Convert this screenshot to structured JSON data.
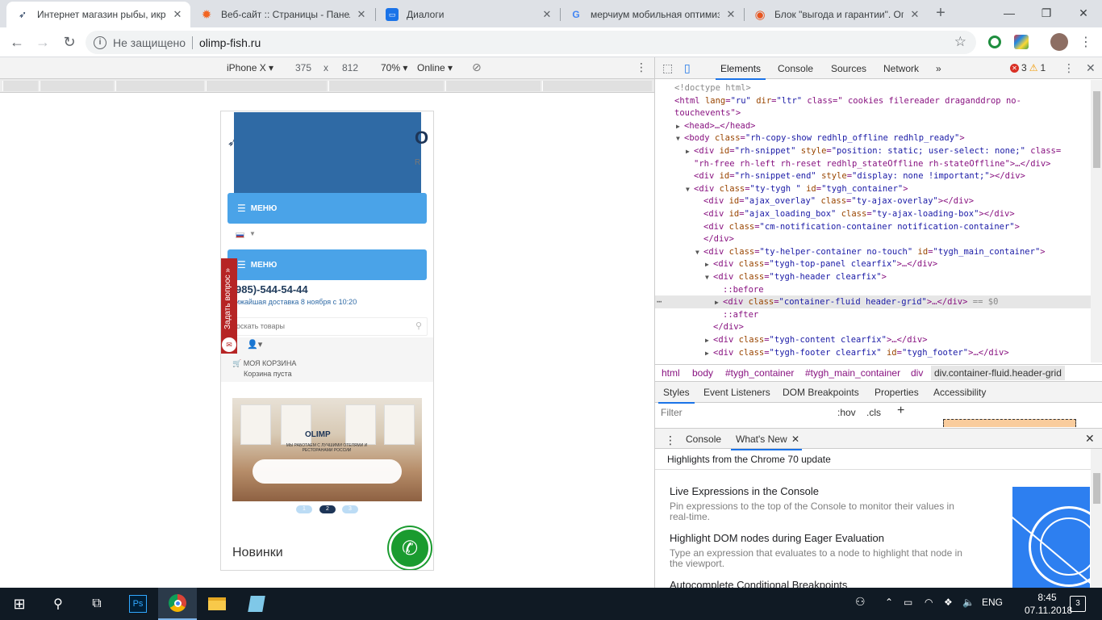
{
  "browser": {
    "tabs": [
      {
        "title": "Интернет магазин рыбы, икр",
        "icon": "olimp-favicon",
        "active": true
      },
      {
        "title": "Веб-сайт :: Страницы - Панел",
        "icon": "gear-favicon",
        "active": false
      },
      {
        "title": "Диалоги",
        "icon": "chat-favicon",
        "active": false
      },
      {
        "title": "мерчиум мобильная оптимиз",
        "icon": "google-favicon",
        "active": false
      },
      {
        "title": "Блок \"выгода и гарантии\". Оп",
        "icon": "support-favicon",
        "active": false
      }
    ],
    "new_tab_icon": "+",
    "minimize_icon": "—",
    "maximize_icon": "❐",
    "close_icon": "✕",
    "security_label": "Не защищено",
    "url": "olimp-fish.ru"
  },
  "device_toolbar": {
    "device": "iPhone X",
    "width": "375",
    "times": "x",
    "height": "812",
    "zoom": "70%",
    "network": "Online"
  },
  "mobile_page": {
    "menu_label": "МЕНЮ",
    "menu_label_2": "МЕНЮ",
    "logo_fragment": "O",
    "logo_fragment_r": "R",
    "phone": "985)-544-54-44",
    "delivery": "ижайшая доставка 8 ноября с 10:20",
    "search_placeholder": "оскать товары",
    "cart_title": "МОЯ КОРЗИНА",
    "cart_subtitle": "Корзина пуста",
    "banner_logo": "OLIMP",
    "banner_text": "МЫ РАБОТАЕМ С ЛУЧШИМИ ОТЕЛЯМИ И РЕСТОРАНАМИ РОССИИ",
    "slider_dots": [
      "1",
      "2",
      "3"
    ],
    "active_dot": 2,
    "section_title": "Новинки",
    "ask_question": "Задать вопрос »"
  },
  "devtools": {
    "tabs": [
      "Elements",
      "Console",
      "Sources",
      "Network"
    ],
    "more": "»",
    "errors": "3",
    "warnings": "1",
    "dom_lines": [
      {
        "indent": 0,
        "tri": "",
        "html": "<!doctype html>",
        "type": "comment"
      },
      {
        "indent": 0,
        "tri": "",
        "text": "<html lang=\"ru\" dir=\"ltr\" class=\" cookies filereader draganddrop no-"
      },
      {
        "indent": 0,
        "tri": "",
        "text": "touchevents\">"
      },
      {
        "indent": 1,
        "tri": "▶",
        "text": "<head>…</head>"
      },
      {
        "indent": 1,
        "tri": "▼",
        "text": "<body class=\"rh-copy-show redhlp_offline redhlp_ready\">"
      },
      {
        "indent": 2,
        "tri": "▶",
        "text": "<div id=\"rh-snippet\" style=\"position: static; user-select: none;\" class="
      },
      {
        "indent": 2,
        "tri": "",
        "text": "\"rh-free rh-left rh-reset redhlp_stateOffline rh-stateOffline\">…</div>"
      },
      {
        "indent": 2,
        "tri": "",
        "text": "<div id=\"rh-snippet-end\" style=\"display: none !important;\"></div>"
      },
      {
        "indent": 2,
        "tri": "▼",
        "text": "<div class=\"ty-tygh  \" id=\"tygh_container\">"
      },
      {
        "indent": 3,
        "tri": "",
        "text": "<div id=\"ajax_overlay\" class=\"ty-ajax-overlay\"></div>"
      },
      {
        "indent": 3,
        "tri": "",
        "text": "<div id=\"ajax_loading_box\" class=\"ty-ajax-loading-box\"></div>"
      },
      {
        "indent": 3,
        "tri": "",
        "text": "<div class=\"cm-notification-container notification-container\">"
      },
      {
        "indent": 3,
        "tri": "",
        "text": "</div>"
      },
      {
        "indent": 3,
        "tri": "▼",
        "text": "<div class=\"ty-helper-container no-touch\" id=\"tygh_main_container\">"
      },
      {
        "indent": 4,
        "tri": "▶",
        "text": "<div class=\"tygh-top-panel clearfix\">…</div>"
      },
      {
        "indent": 4,
        "tri": "▼",
        "text": "<div class=\"tygh-header clearfix\">"
      },
      {
        "indent": 5,
        "tri": "",
        "text": "::before"
      },
      {
        "indent": 5,
        "tri": "▶",
        "text": "<div class=\"container-fluid  header-grid\">…</div> == $0",
        "selected": true
      },
      {
        "indent": 5,
        "tri": "",
        "text": "::after"
      },
      {
        "indent": 4,
        "tri": "",
        "text": "</div>"
      },
      {
        "indent": 4,
        "tri": "▶",
        "text": "<div class=\"tygh-content clearfix\">…</div>"
      },
      {
        "indent": 4,
        "tri": "▶",
        "text": "<div class=\"tygh-footer clearfix\" id=\"tygh_footer\">…</div>"
      }
    ],
    "breadcrumbs": [
      "html",
      "body",
      "#tygh_container",
      "#tygh_main_container",
      "div",
      "div.container-fluid.header-grid"
    ],
    "styles_tabs": [
      "Styles",
      "Event Listeners",
      "DOM Breakpoints",
      "Properties",
      "Accessibility"
    ],
    "filter_placeholder": "Filter",
    "hov": ":hov",
    "cls": ".cls",
    "plus": "+",
    "drawer_tabs": [
      "Console",
      "What's New"
    ],
    "whats_new_header": "Highlights from the Chrome 70 update",
    "features": [
      {
        "title": "Live Expressions in the Console",
        "desc": "Pin expressions to the top of the Console to monitor their values in real-time."
      },
      {
        "title": "Highlight DOM nodes during Eager Evaluation",
        "desc": "Type an expression that evaluates to a node to highlight that node in the viewport."
      },
      {
        "title": "Autocomplete Conditional Breakpoints",
        "desc": ""
      }
    ]
  },
  "taskbar": {
    "language": "ENG",
    "time": "8:45",
    "date": "07.11.2018",
    "notifications": "3"
  }
}
